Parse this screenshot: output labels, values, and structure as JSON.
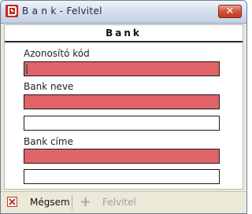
{
  "window": {
    "title": "B a n k - Felvitel",
    "close_label": "✕"
  },
  "form": {
    "section_title": "Bank",
    "fields": [
      {
        "label": "Azonosító kód",
        "value": "",
        "required": true
      },
      {
        "label": "Bank neve",
        "value": "",
        "required": true
      },
      {
        "label": "",
        "value": "",
        "required": false
      },
      {
        "label": "Bank címe",
        "value": "",
        "required": true
      },
      {
        "label": "",
        "value": "",
        "required": false
      }
    ]
  },
  "toolbar": {
    "cancel_label": "Mégsem",
    "submit_label": "Felvitel",
    "submit_enabled": false
  },
  "colors": {
    "required_field": "#e06468",
    "title_bar": "#d6e0ee",
    "close_button": "#d4543c"
  }
}
